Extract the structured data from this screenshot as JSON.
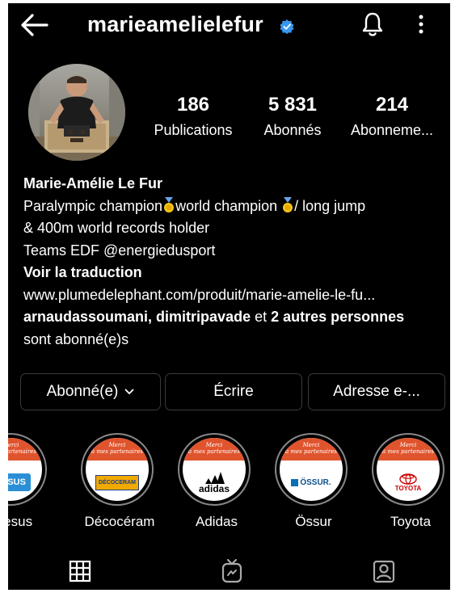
{
  "header": {
    "username": "marieamelielefur"
  },
  "stats": [
    {
      "value": "186",
      "label": "Publications"
    },
    {
      "value": "5 831",
      "label": "Abonnés"
    },
    {
      "value": "214",
      "label": "Abonneme..."
    }
  ],
  "bio": {
    "name": "Marie-Amélie Le Fur",
    "line1_a": "Paralympic champion",
    "line1_b": "world champion ",
    "line1_c": "/ long jump",
    "line2": "& 400m world records holder",
    "line3": "Teams EDF @energiedusport",
    "translate": "Voir la traduction",
    "link": "www.plumedelephant.com/produit/marie-amelie-le-fu...",
    "followed_a": "arnaudassoumani, dimitripavade",
    "followed_b": " et ",
    "followed_c": "2 autres personnes",
    "followed_d": "sont abonné(e)s"
  },
  "buttons": {
    "follow": "Abonné(e)",
    "message": "Écrire",
    "email": "Adresse e-..."
  },
  "highlights": {
    "band_text_1": "Merci",
    "band_text_2": "à mes partenaires",
    "items": [
      {
        "label": "Hesus",
        "logo": "HESUS"
      },
      {
        "label": "Décocéram",
        "logo": "DÉCOCERAM"
      },
      {
        "label": "Adidas",
        "logo": "adidas"
      },
      {
        "label": "Össur",
        "logo": "ÖSSUR."
      },
      {
        "label": "Toyota",
        "logo": "TOYOTA"
      }
    ]
  },
  "colors": {
    "background": "#000000",
    "verified": "#3897f0",
    "band": "#e0542d",
    "medal": "#f5c518"
  },
  "icons": [
    "back-arrow-icon",
    "verified-badge-icon",
    "bell-icon",
    "more-vertical-icon",
    "grid-icon",
    "igtv-icon",
    "tagged-icon"
  ]
}
